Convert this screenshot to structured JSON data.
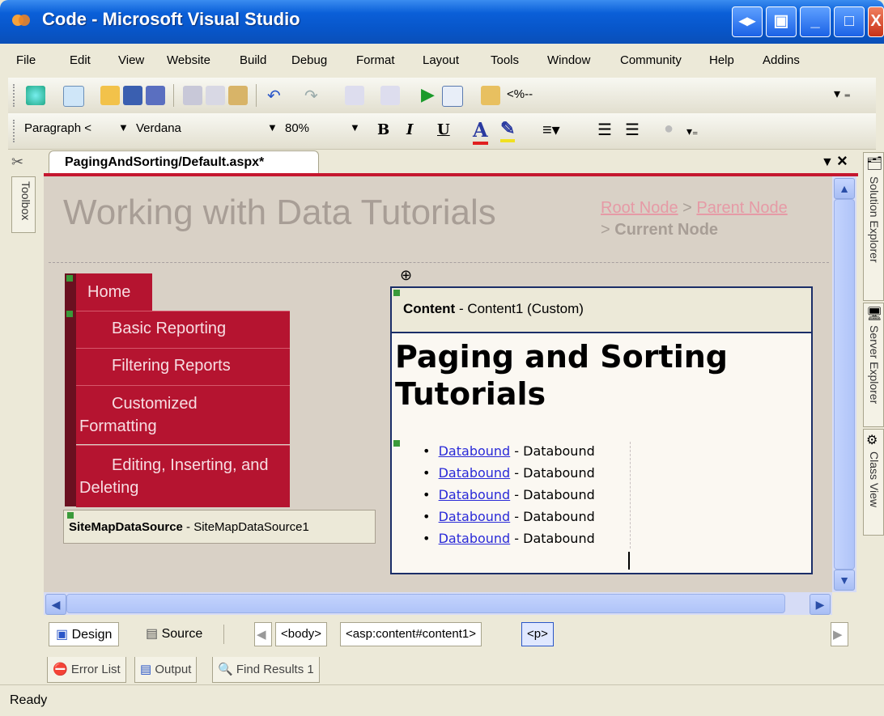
{
  "window": {
    "title": "Code - Microsoft Visual Studio"
  },
  "menu": [
    "File",
    "Edit",
    "View",
    "Website",
    "Build",
    "Debug",
    "Format",
    "Layout",
    "Tools",
    "Window",
    "Community",
    "Help",
    "Addins"
  ],
  "toolbar1": {
    "snippet_combo": "<%--"
  },
  "toolbar2": {
    "block_format": "Paragraph <",
    "font_name": "Verdana",
    "font_size": "80%"
  },
  "sidebars": {
    "left": "Toolbox",
    "right": [
      "Solution Explorer",
      "Server Explorer",
      "Class View"
    ]
  },
  "document_tab": {
    "label": "PagingAndSorting/Default.aspx*"
  },
  "design": {
    "site_title": "Working with Data Tutorials",
    "breadcrumb": {
      "root": "Root Node",
      "sep1": " > ",
      "parent": "Parent Node",
      "sep2": " > ",
      "current": "Current Node"
    },
    "menu": {
      "home": "Home",
      "items": [
        "Basic Reporting",
        "Filtering Reports",
        "Customized Formatting",
        "Editing, Inserting, and Deleting"
      ]
    },
    "sitemap_ds": {
      "type": "SiteMapDataSource",
      "id": " - SiteMapDataSource1"
    },
    "content": {
      "header_type": "Content",
      "header_id": " - Content1 (Custom)",
      "heading": "Paging and Sorting Tutorials",
      "list": [
        {
          "link": "Databound",
          "desc": " - Databound"
        },
        {
          "link": "Databound",
          "desc": " - Databound"
        },
        {
          "link": "Databound",
          "desc": " - Databound"
        },
        {
          "link": "Databound",
          "desc": " - Databound"
        },
        {
          "link": "Databound",
          "desc": " - Databound"
        }
      ]
    }
  },
  "viewbar": {
    "design": "Design",
    "source": "Source",
    "tags": [
      "<body>",
      "<asp:content#content1>",
      "<p>"
    ]
  },
  "toolwindows": [
    "Error List",
    "Output",
    "Find Results 1"
  ],
  "status": "Ready",
  "colors": {
    "menu_red": "#b51430",
    "title_blue": "#0a5fd8"
  }
}
